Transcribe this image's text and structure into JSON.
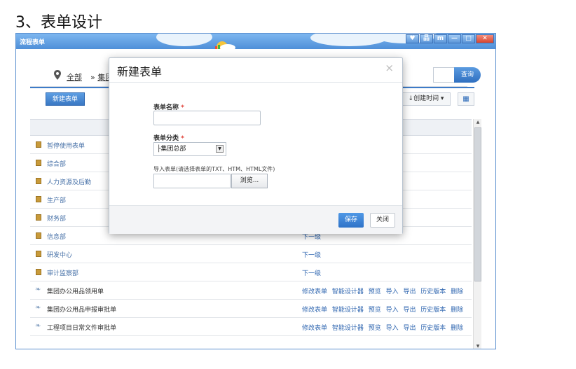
{
  "heading": "3、表单设计",
  "window": {
    "title": "流程表单",
    "buttons": [
      "♥",
      "品",
      "m",
      "—",
      "□",
      "✕"
    ]
  },
  "breadcrumb": {
    "all": "全部",
    "sep": "»",
    "current": "集团"
  },
  "search": {
    "button": "查询"
  },
  "toolbar": {
    "new_form": "新建表单",
    "sort": "↓创建时间 ▾",
    "grid_icon": "grid-view-icon"
  },
  "rows": [
    {
      "name": "暂停使用表单",
      "type": "folder",
      "actions": ""
    },
    {
      "name": "综合部",
      "type": "folder",
      "actions": ""
    },
    {
      "name": "人力资源及后勤",
      "type": "folder",
      "actions": ""
    },
    {
      "name": "生产部",
      "type": "folder",
      "actions": ""
    },
    {
      "name": "财务部",
      "type": "folder",
      "actions": ""
    },
    {
      "name": "信息部",
      "type": "folder",
      "actions": "下一级"
    },
    {
      "name": "研发中心",
      "type": "folder",
      "actions": "下一级"
    },
    {
      "name": "审计监察部",
      "type": "folder",
      "actions": "下一级"
    },
    {
      "name": "集团办公用品领用单",
      "type": "doc",
      "actions": "修改表单 智能设计器 预览 导入 导出 历史版本 删除"
    },
    {
      "name": "集团办公用品申报审批单",
      "type": "doc",
      "actions": "修改表单 智能设计器 预览 导入 导出 历史版本 删除"
    },
    {
      "name": "工程项目日常文件审批单",
      "type": "doc",
      "actions": "修改表单 智能设计器 预览 导入 导出 历史版本 删除"
    }
  ],
  "modal": {
    "title": "新建表单",
    "close": "×",
    "name_label": "表单名称",
    "required": "*",
    "name_value": "",
    "category_label": "表单分类",
    "category_value": "├集团总部",
    "import_label": "导入表单(请选择表单的TXT、HTM、HTML文件)",
    "browse": "浏览...",
    "save": "保存",
    "cancel": "关闭"
  },
  "colors": {
    "accent": "#3a78c4",
    "link": "#2f66b0",
    "required": "#e0433a"
  }
}
